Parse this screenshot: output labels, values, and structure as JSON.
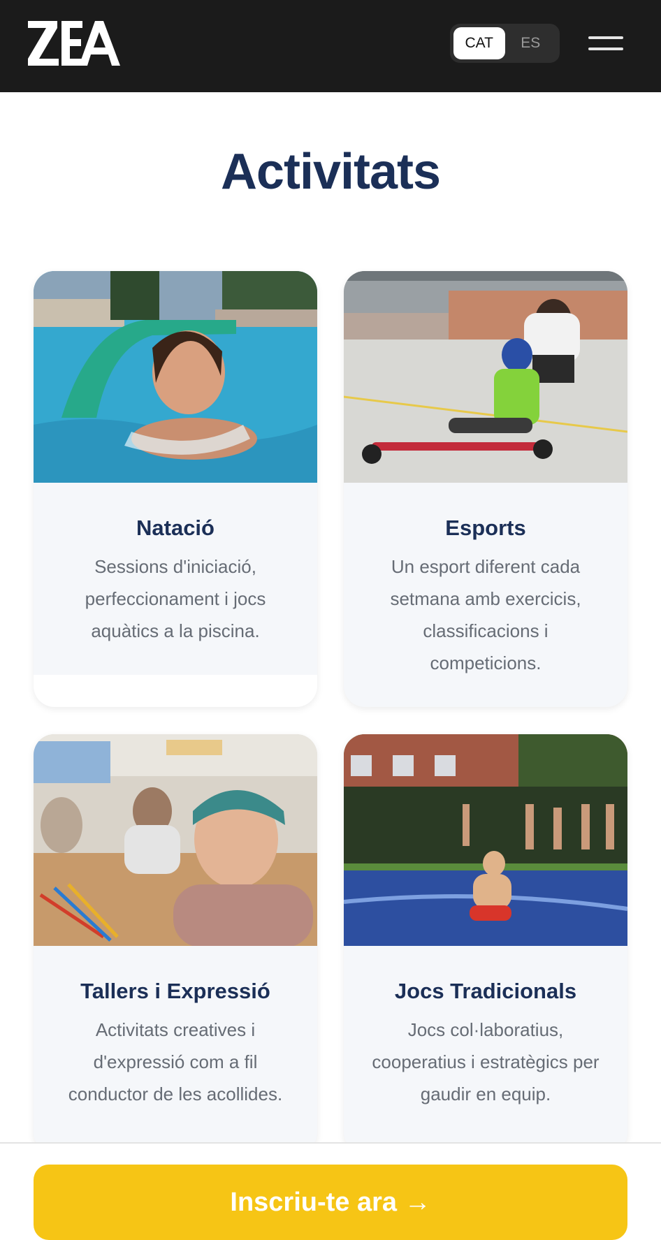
{
  "header": {
    "logo_text": "ZEA",
    "languages": [
      "CAT",
      "ES"
    ],
    "active_language": "CAT",
    "menu_icon": "hamburger-menu-icon"
  },
  "main": {
    "title": "Activitats",
    "activities": [
      {
        "title": "Natació",
        "description": "Sessions d'iniciació, perfeccionament i jocs aquàtics a la piscina.",
        "photo": "girl swimming in pool with green noodle"
      },
      {
        "title": "Esports",
        "description": "Un esport diferent cada setmana amb exercicis, classificacions i competicions.",
        "photo": "child on kick scooter pushed by monitor in sports court"
      },
      {
        "title": "Tallers i Expressió",
        "description": "Activitats creatives i d'expressió com a fil conductor de les acollides.",
        "photo": "boy with cap smiling at craft table"
      },
      {
        "title": "Jocs Tradicionals",
        "description": "Jocs col·laboratius, cooperatius i estratègics per gaudir en equip.",
        "photo": "boy sliding on blue wet tarp in garden"
      }
    ]
  },
  "cta": {
    "label": "Inscriu-te ara →"
  },
  "colors": {
    "header_bg": "#1b1b1b",
    "title": "#1b2f57",
    "card_bg": "#f5f7fa",
    "cta_bg": "#f6c515",
    "text_muted": "#666c75"
  }
}
